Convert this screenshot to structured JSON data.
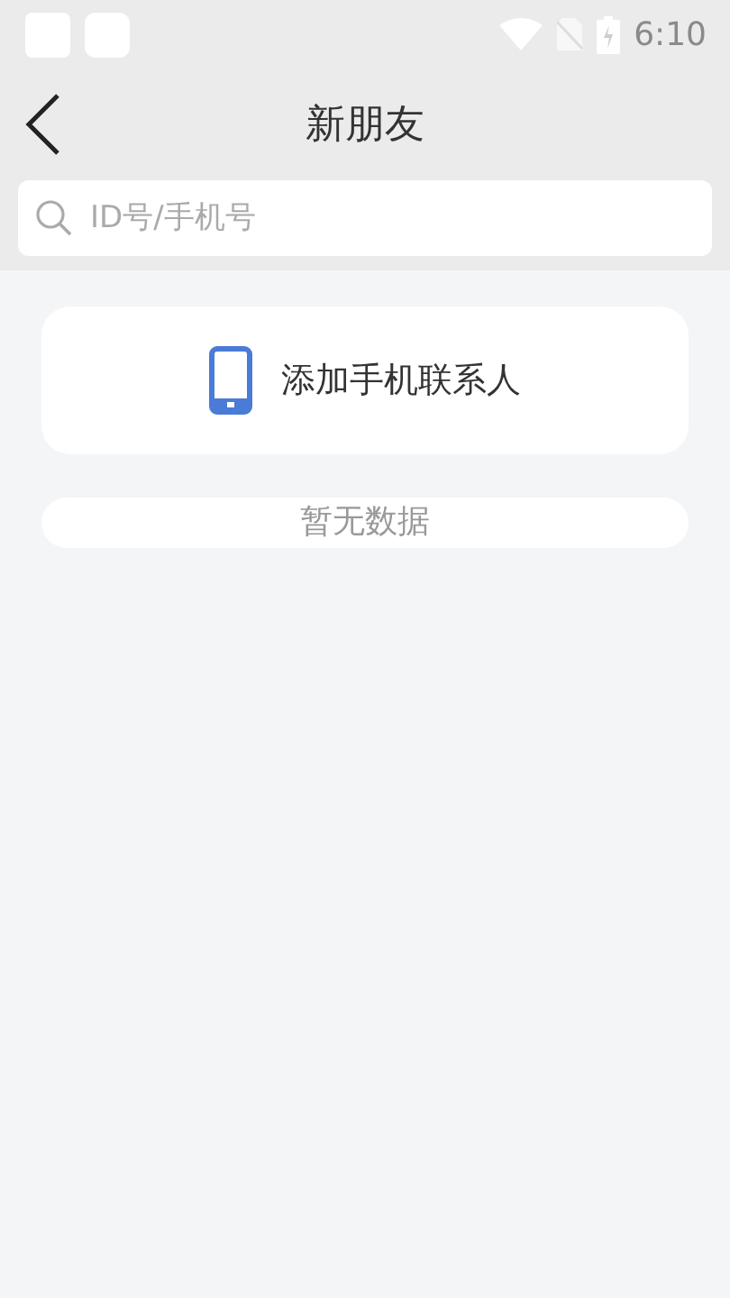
{
  "status_bar": {
    "time": "6:10"
  },
  "header": {
    "title": "新朋友"
  },
  "search": {
    "placeholder": "ID号/手机号"
  },
  "add_contacts": {
    "label": "添加手机联系人"
  },
  "empty_message": "暂无数据"
}
